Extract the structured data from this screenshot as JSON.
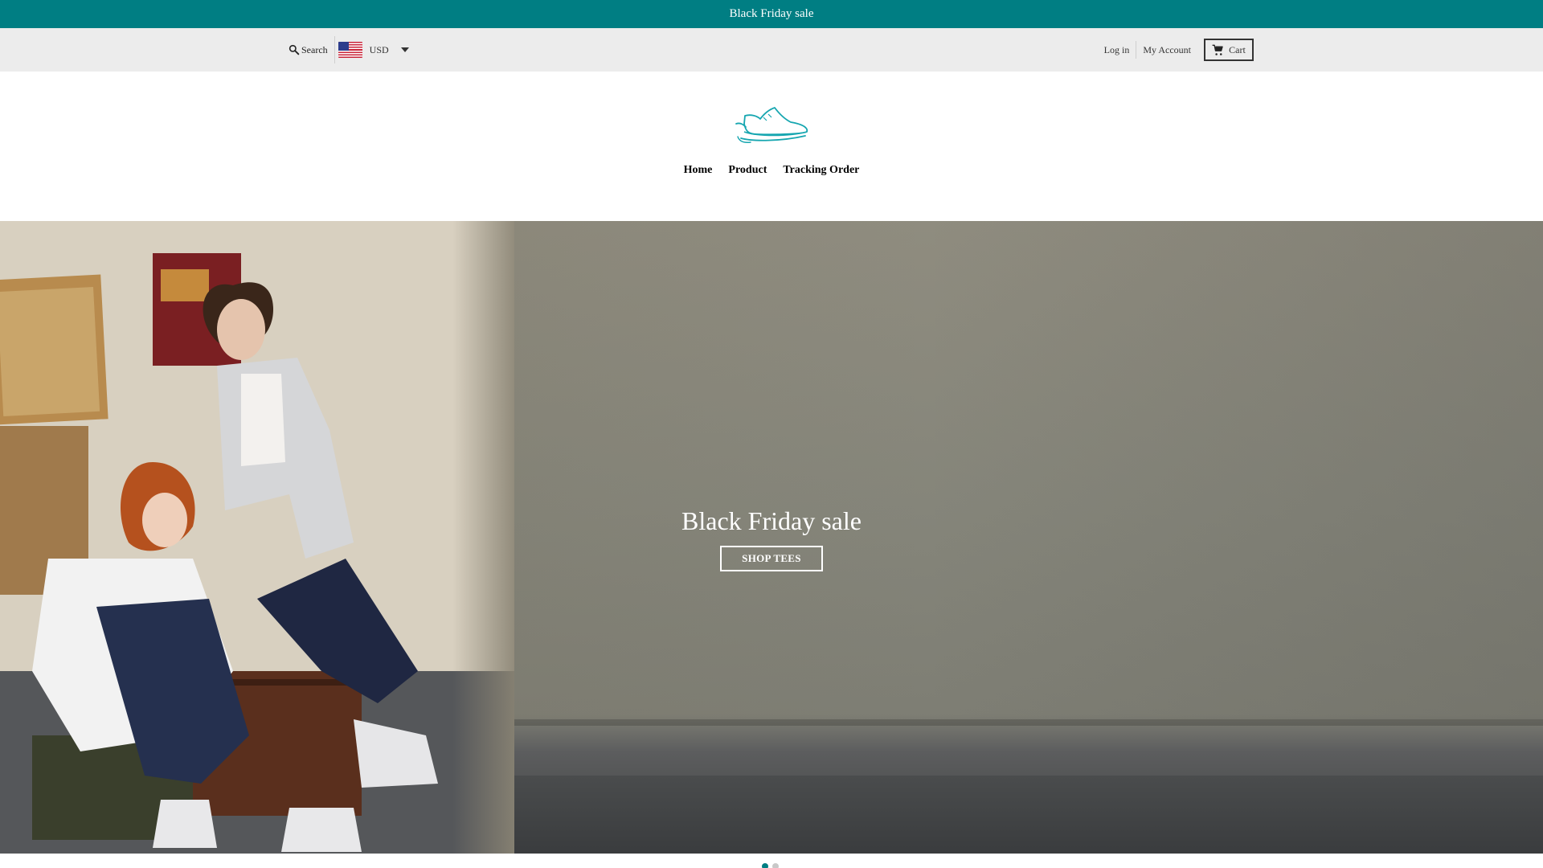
{
  "announcement": {
    "text": "Black Friday sale"
  },
  "utility": {
    "search_label": "Search",
    "currency": {
      "code": "USD",
      "flag": "us-flag-icon"
    },
    "login_label": "Log in",
    "account_label": "My Account",
    "cart_label": "Cart"
  },
  "brand": {
    "logo": "sneaker-logo",
    "accent": "#007e83"
  },
  "nav": {
    "items": [
      {
        "label": "Home"
      },
      {
        "label": "Product"
      },
      {
        "label": "Tracking Order"
      }
    ]
  },
  "hero": {
    "title": "Black Friday sale",
    "button_label": "SHOP TEES",
    "slides": {
      "count": 2,
      "active": 1
    }
  },
  "colors": {
    "announcement_bg": "#007e83",
    "utility_bg": "#ececec"
  }
}
